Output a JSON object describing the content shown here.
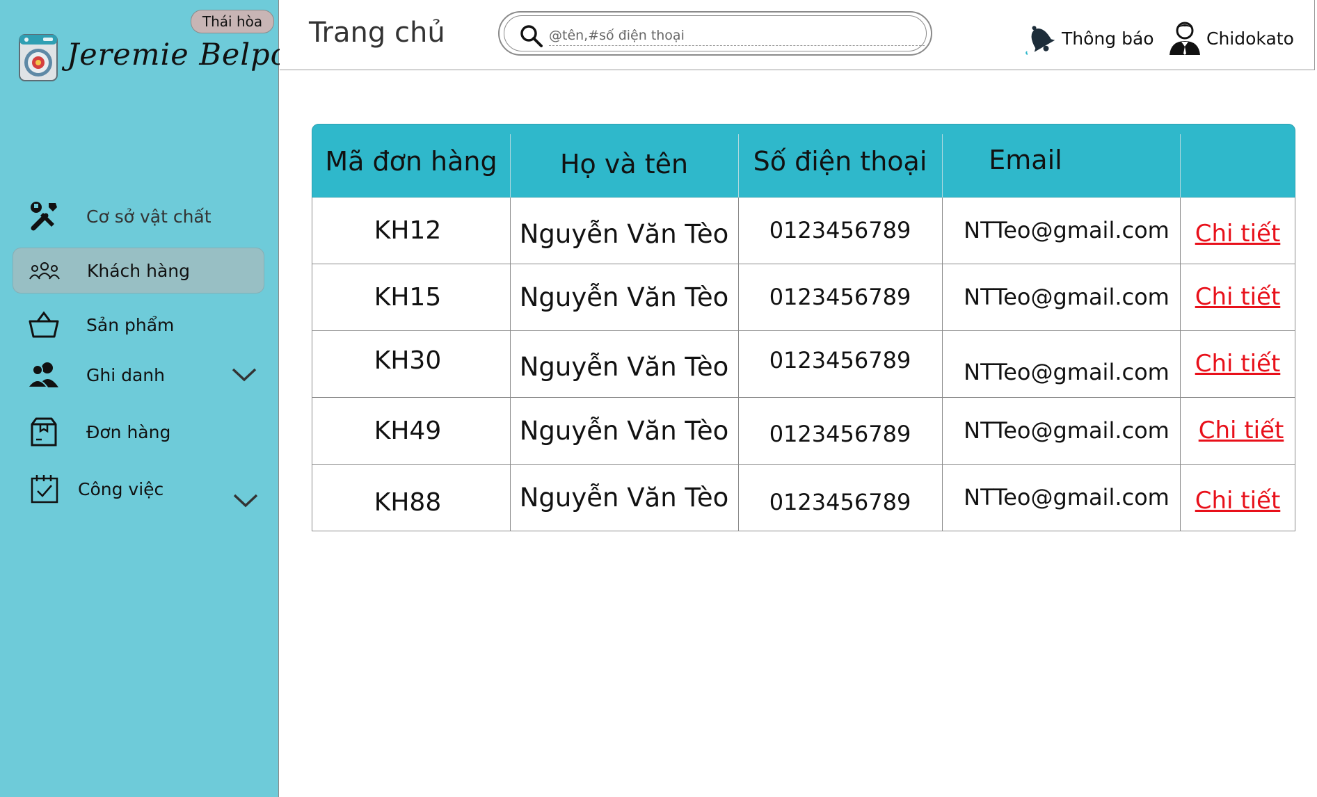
{
  "sidebar": {
    "badge": "Thái hòa",
    "brand": "Jeremie Belpois",
    "items": [
      {
        "label": "Cơ sở vật chất"
      },
      {
        "label": "Khách hàng"
      },
      {
        "label": "Sản phẩm"
      },
      {
        "label": "Ghi danh"
      },
      {
        "label": "Đơn hàng"
      },
      {
        "label": "Công việc"
      }
    ]
  },
  "header": {
    "title": "Trang chủ",
    "search_placeholder": "@tên,#số điện thoại",
    "notify_label": "Thông báo",
    "user_label": "Chidokato"
  },
  "table": {
    "headers": [
      "Mã đơn hàng",
      "Họ và tên",
      "Số điện thoại",
      "Email",
      ""
    ],
    "rows": [
      {
        "code": "KH12",
        "name": "Nguyễn Văn Tèo",
        "phone": "0123456789",
        "email": "NTTeo@gmail.com",
        "action": "Chi tiết"
      },
      {
        "code": "KH15",
        "name": "Nguyễn Văn Tèo",
        "phone": "0123456789",
        "email": "NTTeo@gmail.com",
        "action": "Chi tiết"
      },
      {
        "code": "KH30",
        "name": "Nguyễn Văn Tèo",
        "phone": "0123456789",
        "email": "NTTeo@gmail.com",
        "action": "Chi tiết"
      },
      {
        "code": "KH49",
        "name": "Nguyễn Văn Tèo",
        "phone": "0123456789",
        "email": "NTTeo@gmail.com",
        "action": "Chi tiết"
      },
      {
        "code": "KH88",
        "name": "Nguyễn Văn Tèo",
        "phone": "0123456789",
        "email": "NTTeo@gmail.com",
        "action": "Chi tiết"
      }
    ]
  },
  "colors": {
    "sidebar_bg": "#6ecbd9",
    "active_item_bg": "#98bfc4",
    "table_header_bg": "#2fb8cb",
    "link": "#e8101a"
  },
  "icons": {
    "logo": "washing-machine-icon",
    "facilities": "tools-icon",
    "customers": "people-group-icon",
    "products": "basket-icon",
    "enroll": "users-icon",
    "orders": "package-icon",
    "tasks": "calendar-check-icon",
    "search": "search-icon",
    "notify": "bell-icon",
    "user": "user-avatar-icon"
  }
}
